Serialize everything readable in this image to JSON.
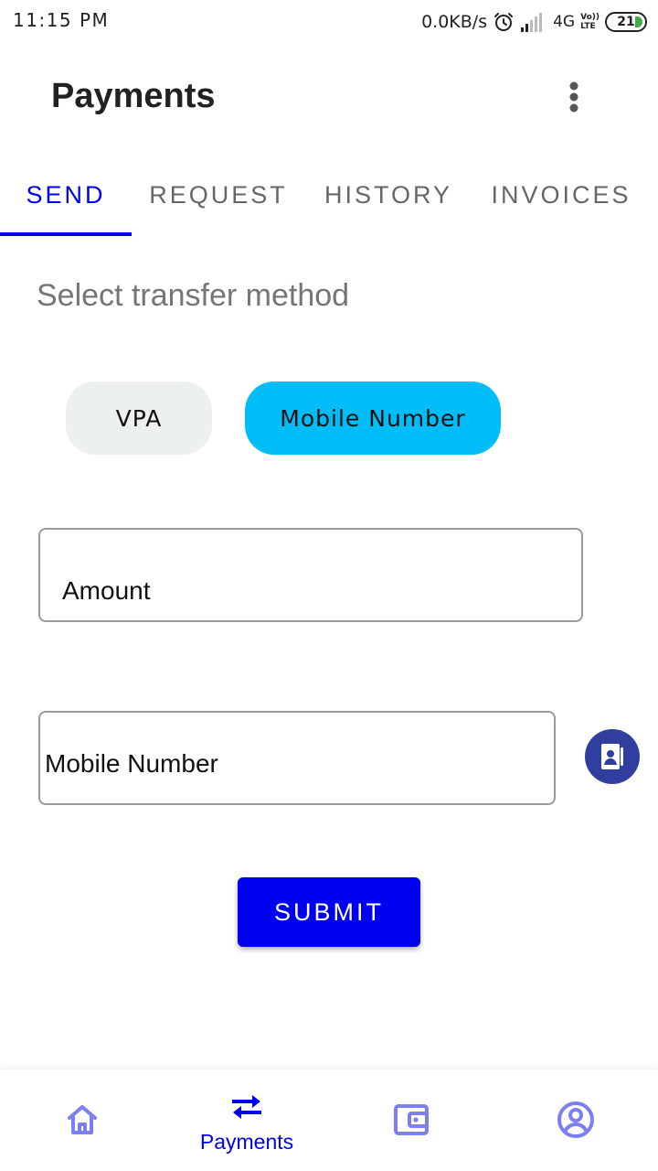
{
  "status_bar": {
    "time": "11:15 PM",
    "net_speed": "0.0KB/s",
    "network_type": "4G",
    "volte_top": "Vo))",
    "volte_bottom": "LTE",
    "battery": "21"
  },
  "app_bar": {
    "title": "Payments",
    "more_icon": "more-vert-icon"
  },
  "tabs": [
    {
      "label": "SEND",
      "active": true
    },
    {
      "label": "REQUEST",
      "active": false
    },
    {
      "label": "HISTORY",
      "active": false
    },
    {
      "label": "INVOICES",
      "active": false
    }
  ],
  "transfer": {
    "section_label": "Select transfer method",
    "methods": [
      {
        "label": "VPA",
        "selected": false
      },
      {
        "label": "Mobile Number",
        "selected": true
      }
    ]
  },
  "form": {
    "amount_placeholder": "Amount",
    "mobile_placeholder": "Mobile Number",
    "contacts_icon": "contacts-icon",
    "submit_label": "SUBMIT"
  },
  "bottom_nav": {
    "items": [
      {
        "icon": "home-icon",
        "label": "",
        "active": false
      },
      {
        "icon": "swap-arrows-icon",
        "label": "Payments",
        "active": true
      },
      {
        "icon": "wallet-icon",
        "label": "",
        "active": false
      },
      {
        "icon": "account-icon",
        "label": "",
        "active": false
      }
    ]
  },
  "colors": {
    "accent": "#0000ee",
    "selected_chip": "#00bdf7",
    "unselected_chip": "#edf0f1",
    "contacts_button": "#303f9f",
    "nav_icon": "#7b7ff0"
  }
}
